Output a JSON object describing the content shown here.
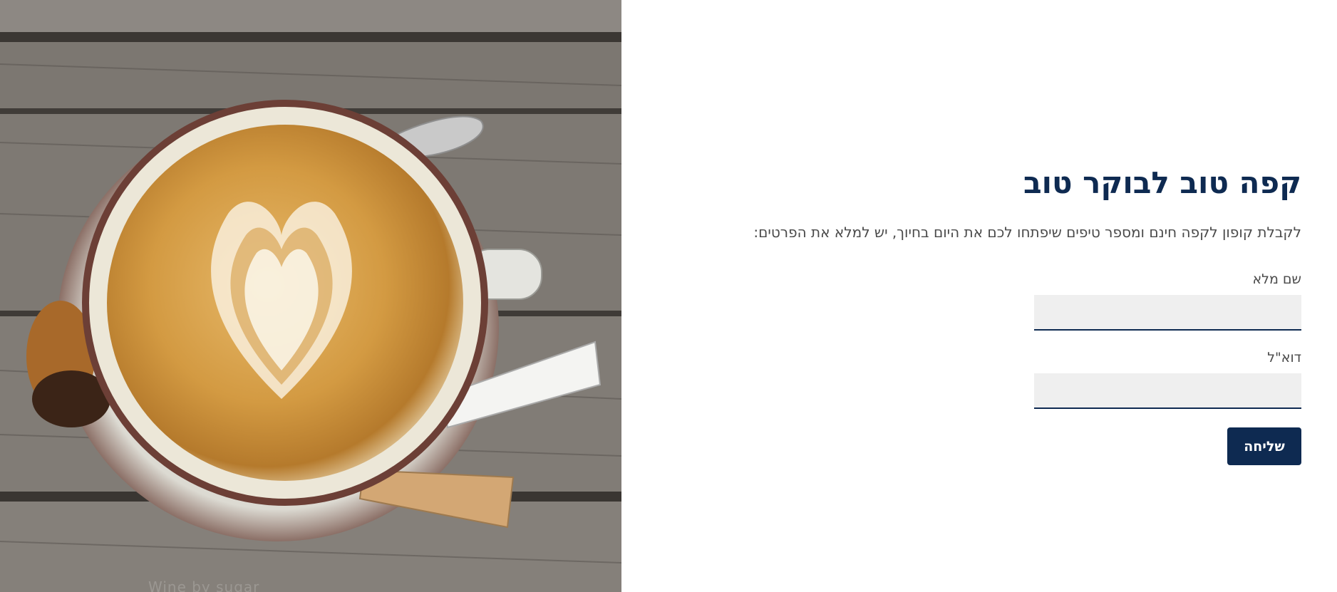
{
  "hero": {
    "image_name": "latte-art-coffee-cup-on-wooden-table-photo",
    "watermark_text": "Wine by sugar"
  },
  "form": {
    "title": "קפה טוב לבוקר טוב",
    "subtitle": "לקבלת קופון לקפה חינם ומספר טיפים שיפתחו לכם את היום בחיוך, יש למלא את הפרטים:",
    "fields": [
      {
        "label": "שם מלא",
        "value": "",
        "placeholder": ""
      },
      {
        "label": "דוא\"ל",
        "value": "",
        "placeholder": ""
      }
    ],
    "submit_label": "שליחה"
  },
  "colors": {
    "brand_navy": "#0e2a51",
    "input_bg": "#efefef",
    "body_text": "#4a4a4a"
  }
}
